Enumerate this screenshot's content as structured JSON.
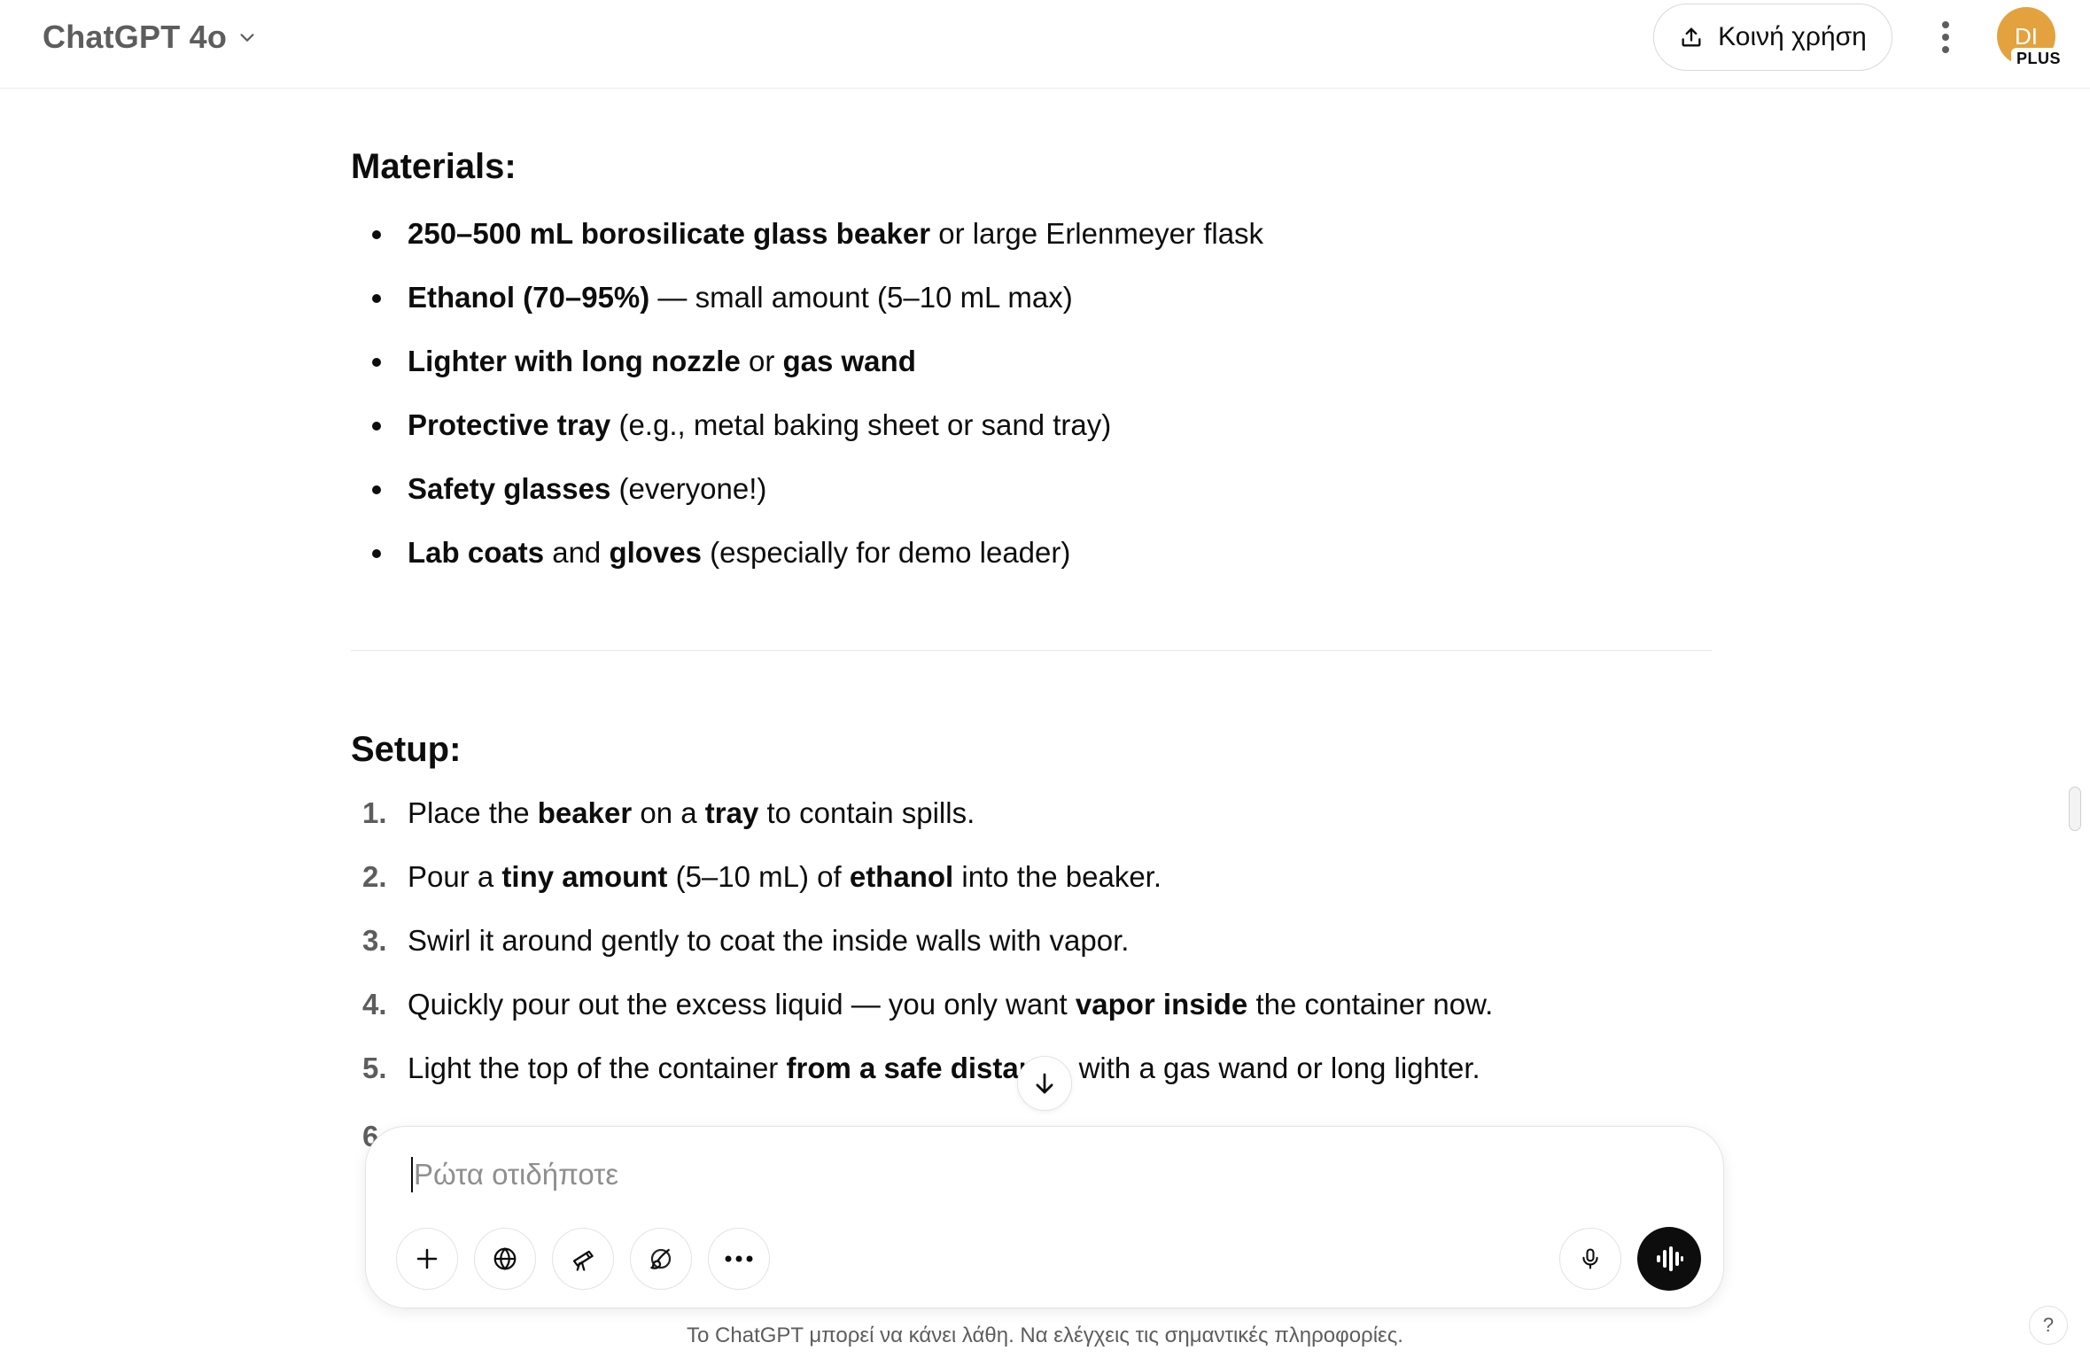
{
  "header": {
    "model_name": "ChatGPT 4o",
    "share_label": "Κοινή χρήση",
    "avatar_initials": "DI",
    "plan_badge": "PLUS"
  },
  "materials": {
    "heading": "Materials:",
    "items": [
      [
        {
          "t": "250–500 mL borosilicate glass beaker",
          "b": true
        },
        {
          "t": " or large Erlenmeyer flask",
          "b": false
        }
      ],
      [
        {
          "t": "Ethanol (70–95%)",
          "b": true
        },
        {
          "t": " — small amount (5–10 mL max)",
          "b": false
        }
      ],
      [
        {
          "t": "Lighter with long nozzle",
          "b": true
        },
        {
          "t": " or ",
          "b": false
        },
        {
          "t": "gas wand",
          "b": true
        }
      ],
      [
        {
          "t": "Protective tray",
          "b": true
        },
        {
          "t": " (e.g., metal baking sheet or sand tray)",
          "b": false
        }
      ],
      [
        {
          "t": "Safety glasses",
          "b": true
        },
        {
          "t": " (everyone!)",
          "b": false
        }
      ],
      [
        {
          "t": "Lab coats",
          "b": true
        },
        {
          "t": " and ",
          "b": false
        },
        {
          "t": "gloves",
          "b": true
        },
        {
          "t": " (especially for demo leader)",
          "b": false
        }
      ]
    ]
  },
  "setup": {
    "heading": "Setup:",
    "items": [
      {
        "num": "1.",
        "parts": [
          {
            "t": "Place the ",
            "b": false
          },
          {
            "t": "beaker",
            "b": true
          },
          {
            "t": " on a ",
            "b": false
          },
          {
            "t": "tray",
            "b": true
          },
          {
            "t": " to contain spills.",
            "b": false
          }
        ]
      },
      {
        "num": "2.",
        "parts": [
          {
            "t": "Pour a ",
            "b": false
          },
          {
            "t": "tiny amount",
            "b": true
          },
          {
            "t": " (5–10 mL) of ",
            "b": false
          },
          {
            "t": "ethanol",
            "b": true
          },
          {
            "t": " into the beaker.",
            "b": false
          }
        ]
      },
      {
        "num": "3.",
        "parts": [
          {
            "t": "Swirl it around gently to coat the inside walls with vapor.",
            "b": false
          }
        ]
      },
      {
        "num": "4.",
        "parts": [
          {
            "t": "Quickly pour out the excess liquid — you only want ",
            "b": false
          },
          {
            "t": "vapor inside",
            "b": true
          },
          {
            "t": " the container now.",
            "b": false
          }
        ]
      },
      {
        "num": "5.",
        "parts": [
          {
            "t": "Light the top of the container ",
            "b": false
          },
          {
            "t": "from a safe distar",
            "b": true
          },
          {
            "t": "      with a gas wand or long lighter.",
            "b": false
          }
        ]
      }
    ],
    "partial_next_number": "6"
  },
  "composer": {
    "placeholder": "Ρώτα οτιδήποτε",
    "value": ""
  },
  "footer": {
    "disclaimer": "Το ChatGPT μπορεί να κάνει λάθη. Να ελέγχεις τις σημαντικές πληροφορίες.",
    "help_label": "?"
  },
  "colors": {
    "accent_avatar": "#e3a23e",
    "text": "#0d0d0d",
    "muted": "#5d5d5d"
  },
  "icons": [
    "chevron-down-icon",
    "share-upload-icon",
    "kebab-menu-icon",
    "arrow-down-icon",
    "plus-icon",
    "globe-icon",
    "telescope-icon",
    "paintbrush-icon",
    "more-horizontal-icon",
    "microphone-icon",
    "voice-waveform-icon"
  ]
}
